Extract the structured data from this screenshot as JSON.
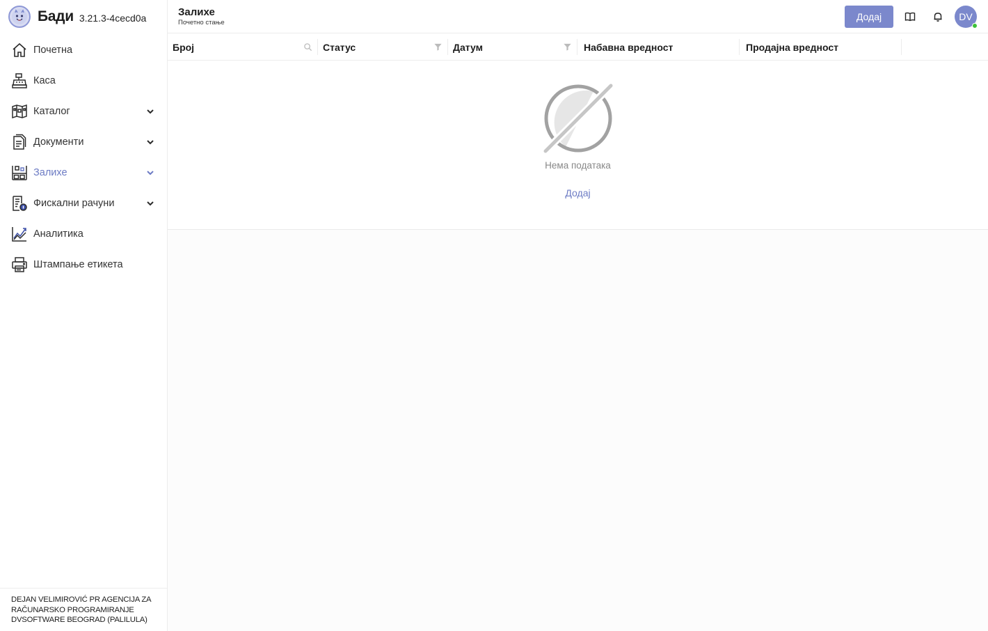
{
  "brand": {
    "name": "Бади",
    "version": "3.21.3-4cecd0a"
  },
  "sidebar": {
    "items": [
      {
        "label": "Почетна",
        "icon": "home-icon",
        "has_submenu": false
      },
      {
        "label": "Каса",
        "icon": "cash-register-icon",
        "has_submenu": false
      },
      {
        "label": "Каталог",
        "icon": "catalog-icon",
        "has_submenu": true
      },
      {
        "label": "Документи",
        "icon": "documents-icon",
        "has_submenu": true
      },
      {
        "label": "Залихе",
        "icon": "warehouse-icon",
        "has_submenu": true,
        "active": true
      },
      {
        "label": "Фискални рачуни",
        "icon": "fiscal-receipt-icon",
        "has_submenu": true
      },
      {
        "label": "Аналитика",
        "icon": "analytics-icon",
        "has_submenu": false
      },
      {
        "label": "Штампање етикета",
        "icon": "printer-icon",
        "has_submenu": false
      }
    ],
    "company": {
      "line1": "DEJAN VELIMIROVIĆ PR AGENCIJA ZA",
      "line2": "RAČUNARSKO PROGRAMIRANJE",
      "line3": "DVSOFTWARE BEOGRAD (PALILULA)"
    }
  },
  "header": {
    "title": "Залихе",
    "subtitle": "Почетно стање",
    "add_label": "Додај",
    "avatar_initials": "DV"
  },
  "table": {
    "columns": [
      {
        "label": "Број",
        "icon": "search-icon"
      },
      {
        "label": "Статус",
        "icon": "filter-icon"
      },
      {
        "label": "Датум",
        "icon": "filter-icon"
      },
      {
        "label": "Набавна вредност",
        "icon": ""
      },
      {
        "label": "Продајна вредност",
        "icon": ""
      }
    ],
    "empty_text": "Нема података",
    "empty_add_label": "Додај"
  },
  "colors": {
    "accent": "#7b88cc",
    "active_text": "#6c7bc4",
    "online": "#3cc13b"
  }
}
